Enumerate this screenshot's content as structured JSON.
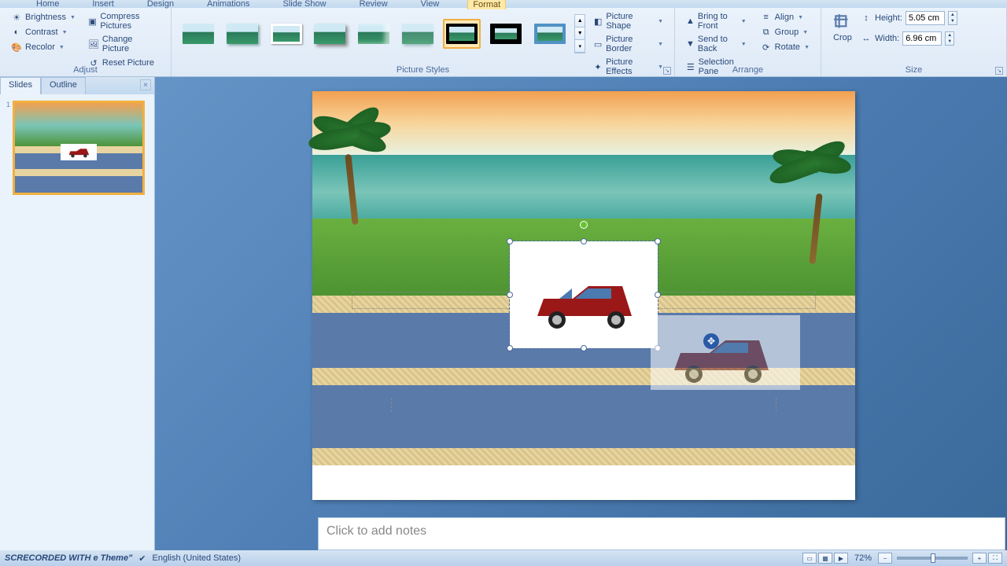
{
  "menubar": {
    "items": [
      "Home",
      "Insert",
      "Design",
      "Animations",
      "Slide Show",
      "Review",
      "View",
      "Format"
    ],
    "active": "Format"
  },
  "ribbon": {
    "adjust": {
      "label": "Adjust",
      "brightness": "Brightness",
      "contrast": "Contrast",
      "recolor": "Recolor",
      "compress": "Compress Pictures",
      "change": "Change Picture",
      "reset": "Reset Picture"
    },
    "pictureStyles": {
      "label": "Picture Styles",
      "shape": "Picture Shape",
      "border": "Picture Border",
      "effects": "Picture Effects"
    },
    "arrange": {
      "label": "Arrange",
      "bringFront": "Bring to Front",
      "sendBack": "Send to Back",
      "selectionPane": "Selection Pane",
      "align": "Align",
      "group": "Group",
      "rotate": "Rotate"
    },
    "size": {
      "label": "Size",
      "crop": "Crop",
      "heightLabel": "Height:",
      "widthLabel": "Width:",
      "height": "5.05 cm",
      "width": "6.96 cm"
    }
  },
  "panel": {
    "tabSlides": "Slides",
    "tabOutline": "Outline",
    "slideNumber": "1"
  },
  "notes": {
    "placeholder": "Click to add notes"
  },
  "status": {
    "recorded": "SCRECORDED WITH e Theme\"",
    "language": "English (United States)",
    "zoom": "72%"
  },
  "colors": {
    "accent": "#f0b040",
    "ribbon": "#eaf2fb",
    "bluebg": "#5a8ac0"
  }
}
